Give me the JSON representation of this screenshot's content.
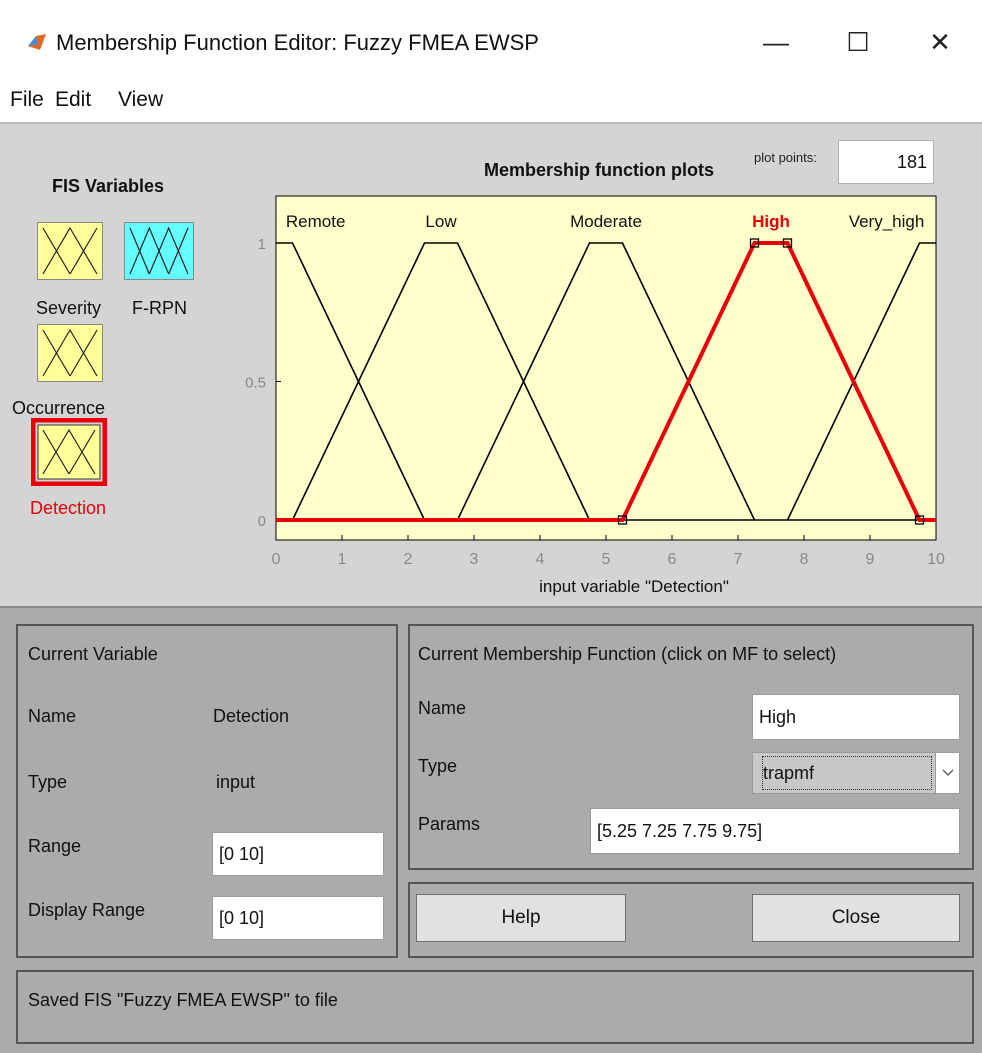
{
  "window": {
    "title": "Membership Function Editor: Fuzzy FMEA EWSP",
    "minimize_glyph": "—",
    "maximize_glyph": "☐",
    "close_glyph": "✕"
  },
  "menu": {
    "file": "File",
    "edit": "Edit",
    "view": "View"
  },
  "fis_variables": {
    "title": "FIS Variables",
    "items": [
      {
        "label": "Severity",
        "kind": "input",
        "selected": false
      },
      {
        "label": "F-RPN",
        "kind": "output",
        "selected": false
      },
      {
        "label": "Occurrence",
        "kind": "input",
        "selected": false
      },
      {
        "label": "Detection",
        "kind": "input",
        "selected": true
      }
    ],
    "colors": {
      "input": "#ffff99",
      "output": "#66ffff",
      "selected_border": "#e8000b",
      "selected_label": "#e8000b"
    }
  },
  "plot": {
    "title": "Membership function plots",
    "plot_points_label": "plot points:",
    "plot_points_value": "181",
    "xlabel": "input variable \"Detection\"",
    "colors": {
      "background": "#ffffcc",
      "line": "#000000",
      "selected": "#e8000b"
    }
  },
  "chart_data": {
    "type": "line",
    "xlim": [
      0,
      10
    ],
    "ylim": [
      0,
      1
    ],
    "xticks": [
      "0",
      "1",
      "2",
      "3",
      "4",
      "5",
      "6",
      "7",
      "8",
      "9",
      "10"
    ],
    "yticks": [
      "0",
      "0.5",
      "1"
    ],
    "xlabel": "input variable \"Detection\"",
    "title": "Membership function plots",
    "series": [
      {
        "name": "Remote",
        "points": [
          [
            0,
            1
          ],
          [
            0.25,
            1
          ],
          [
            2.25,
            0
          ],
          [
            10,
            0
          ]
        ],
        "selected": false
      },
      {
        "name": "Low",
        "points": [
          [
            0.25,
            0
          ],
          [
            2.25,
            1
          ],
          [
            2.75,
            1
          ],
          [
            4.75,
            0
          ]
        ],
        "selected": false
      },
      {
        "name": "Moderate",
        "points": [
          [
            2.75,
            0
          ],
          [
            4.75,
            1
          ],
          [
            5.25,
            1
          ],
          [
            7.25,
            0
          ]
        ],
        "selected": false
      },
      {
        "name": "High",
        "points": [
          [
            0,
            0
          ],
          [
            5.25,
            0
          ],
          [
            7.25,
            1
          ],
          [
            7.75,
            1
          ],
          [
            9.75,
            0
          ],
          [
            10,
            0
          ]
        ],
        "selected": true
      },
      {
        "name": "Very_high",
        "points": [
          [
            7.75,
            0
          ],
          [
            9.75,
            1
          ],
          [
            10,
            1
          ]
        ],
        "selected": false
      }
    ]
  },
  "current_variable": {
    "title": "Current Variable",
    "name_label": "Name",
    "name_value": "Detection",
    "type_label": "Type",
    "type_value": "input",
    "range_label": "Range",
    "range_value": "[0 10]",
    "display_range_label": "Display Range",
    "display_range_value": "[0 10]"
  },
  "current_mf": {
    "title": "Current Membership Function (click on MF to select)",
    "name_label": "Name",
    "name_value": "High",
    "type_label": "Type",
    "type_value": "trapmf",
    "params_label": "Params",
    "params_value": "[5.25 7.25 7.75 9.75]"
  },
  "buttons": {
    "help": "Help",
    "close": "Close"
  },
  "status": "Saved FIS \"Fuzzy FMEA EWSP\" to file"
}
